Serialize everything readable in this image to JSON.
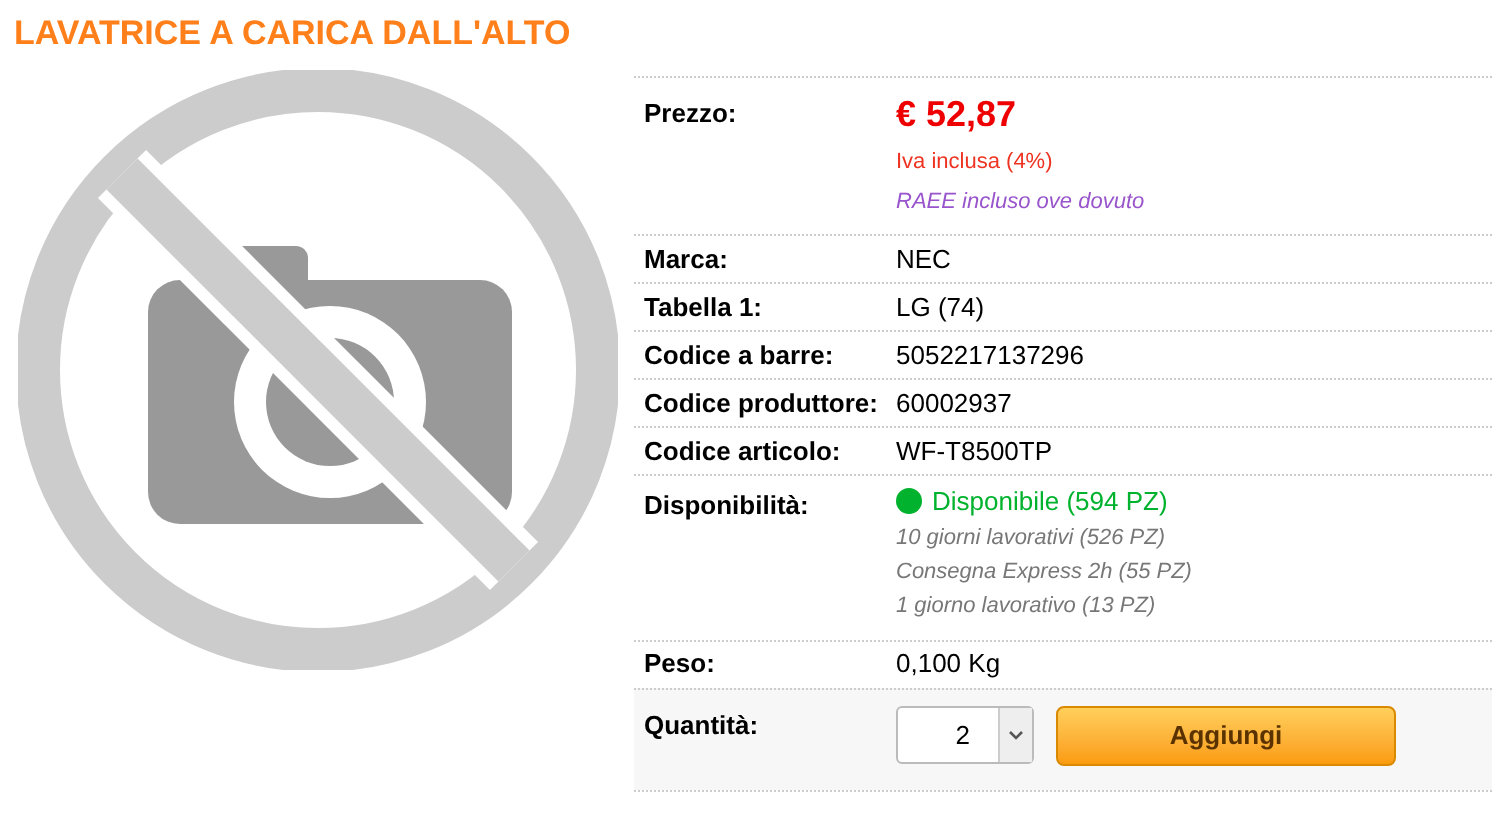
{
  "title": "LAVATRICE A CARICA DALL'ALTO",
  "rows": [
    {
      "kind": "price",
      "label": "Prezzo:",
      "price": "€ 52,87",
      "vat": "Iva inclusa (4%)",
      "note": "RAEE incluso ove dovuto"
    },
    {
      "kind": "text",
      "label": "Marca:",
      "value": "NEC"
    },
    {
      "kind": "text",
      "label": "Tabella 1:",
      "value": "LG (74)"
    },
    {
      "kind": "text",
      "label": "Codice a barre:",
      "value": "5052217137296"
    },
    {
      "kind": "text",
      "label": "Codice produttore:",
      "value": "60002937"
    },
    {
      "kind": "text",
      "label": "Codice articolo:",
      "value": "WF-T8500TP"
    },
    {
      "kind": "availability",
      "label": "Disponibilità:",
      "status": "Disponibile (594 PZ)",
      "color": "#00b22d",
      "lines": [
        "10 giorni lavorativi (526 PZ)",
        "Consegna Express 2h (55 PZ)",
        "1 giorno lavorativo (13 PZ)"
      ]
    },
    {
      "kind": "text",
      "label": "Peso:",
      "value": "0,100 Kg"
    },
    {
      "kind": "quantity",
      "label": "Quantità:",
      "quantity": "2",
      "button": "Aggiungi"
    }
  ]
}
